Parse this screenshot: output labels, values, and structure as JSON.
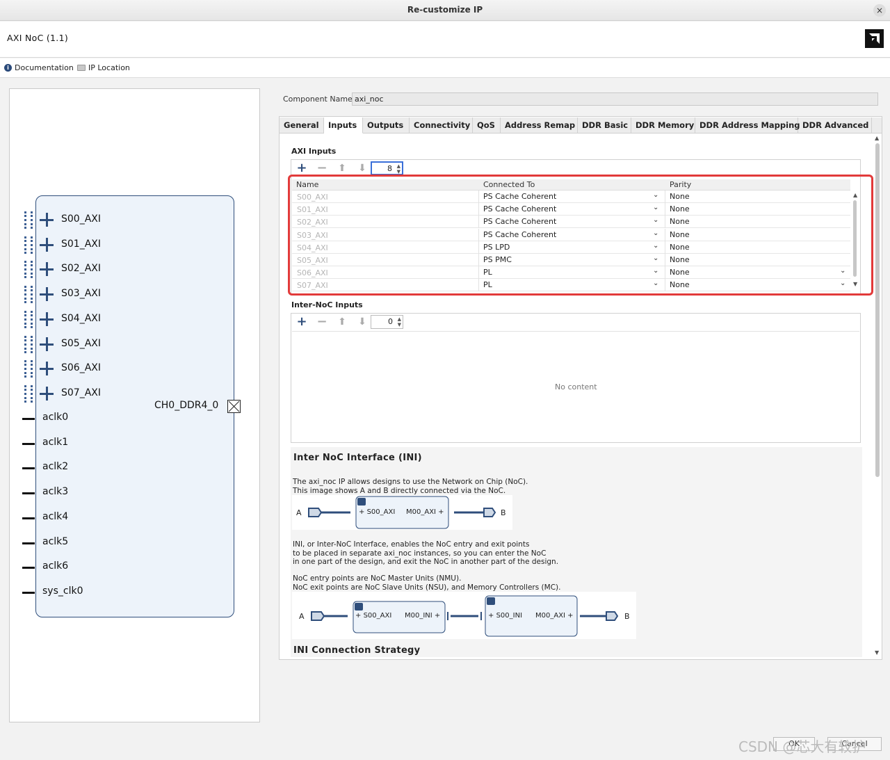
{
  "window": {
    "title": "Re-customize IP",
    "close_glyph": "×"
  },
  "header": {
    "ip_name": "AXI NoC (1.1)"
  },
  "toolbar": {
    "documentation": "Documentation",
    "ip_location": "IP Location"
  },
  "symbol": {
    "axi_ports": [
      "S00_AXI",
      "S01_AXI",
      "S02_AXI",
      "S03_AXI",
      "S04_AXI",
      "S05_AXI",
      "S06_AXI",
      "S07_AXI"
    ],
    "clocks": [
      "aclk0",
      "aclk1",
      "aclk2",
      "aclk3",
      "aclk4",
      "aclk5",
      "aclk6",
      "sys_clk0"
    ],
    "output_port": "CH0_DDR4_0"
  },
  "component": {
    "label": "Component Name",
    "value": "axi_noc"
  },
  "tabs": [
    "General",
    "Inputs",
    "Outputs",
    "Connectivity",
    "QoS",
    "Address Remap",
    "DDR Basic",
    "DDR Memory",
    "DDR Address Mapping",
    "DDR Advanced"
  ],
  "active_tab": "Inputs",
  "axi_inputs": {
    "title": "AXI Inputs",
    "count": "8",
    "columns": [
      "Name",
      "Connected To",
      "Parity"
    ],
    "rows": [
      {
        "name": "S00_AXI",
        "connected": "PS Cache Coherent",
        "parity": "None"
      },
      {
        "name": "S01_AXI",
        "connected": "PS Cache Coherent",
        "parity": "None"
      },
      {
        "name": "S02_AXI",
        "connected": "PS Cache Coherent",
        "parity": "None"
      },
      {
        "name": "S03_AXI",
        "connected": "PS Cache Coherent",
        "parity": "None"
      },
      {
        "name": "S04_AXI",
        "connected": "PS LPD",
        "parity": "None"
      },
      {
        "name": "S05_AXI",
        "connected": "PS PMC",
        "parity": "None"
      },
      {
        "name": "S06_AXI",
        "connected": "PL",
        "parity": "None"
      },
      {
        "name": "S07_AXI",
        "connected": "PL",
        "parity": "None"
      }
    ]
  },
  "inter_noc_inputs": {
    "title": "Inter-NoC Inputs",
    "count": "0",
    "empty_text": "No content"
  },
  "info": {
    "heading": "Inter NoC Interface (INI)",
    "p1": "The axi_noc IP allows designs to use the Network on Chip (NoC).\nThis image shows A and B directly connected via the NoC.",
    "p2": "INI, or Inter-NoC Interface, enables the NoC entry and exit points\nto be placed in separate axi_noc instances, so you can enter the NoC\nin one part of the design, and exit the NoC in another part of the design.",
    "p3": "NoC entry points are NoC Master Units (NMU).\nNoC exit points are NoC Slave Units (NSU), and Memory Controllers (MC).",
    "diag1": {
      "a": "A",
      "b": "B",
      "s": "S00_AXI",
      "m": "M00_AXI"
    },
    "diag2": {
      "a": "A",
      "b": "B",
      "s1": "S00_AXI",
      "m1": "M00_INI",
      "s2": "S00_INI",
      "m2": "M00_AXI"
    },
    "strategy": "INI Connection Strategy"
  },
  "footer": {
    "watermark": "CSDN @芯大有较护",
    "ok": "OK",
    "cancel": "Cancel"
  },
  "colors": {
    "accent": "#2f4e7b",
    "highlight": "#e23a3a"
  },
  "icons": [
    "close-icon",
    "info-icon",
    "folder-icon",
    "logo-icon",
    "plus-icon",
    "minus-icon",
    "up-arrow-icon",
    "down-arrow-icon",
    "dropdown-icon"
  ]
}
